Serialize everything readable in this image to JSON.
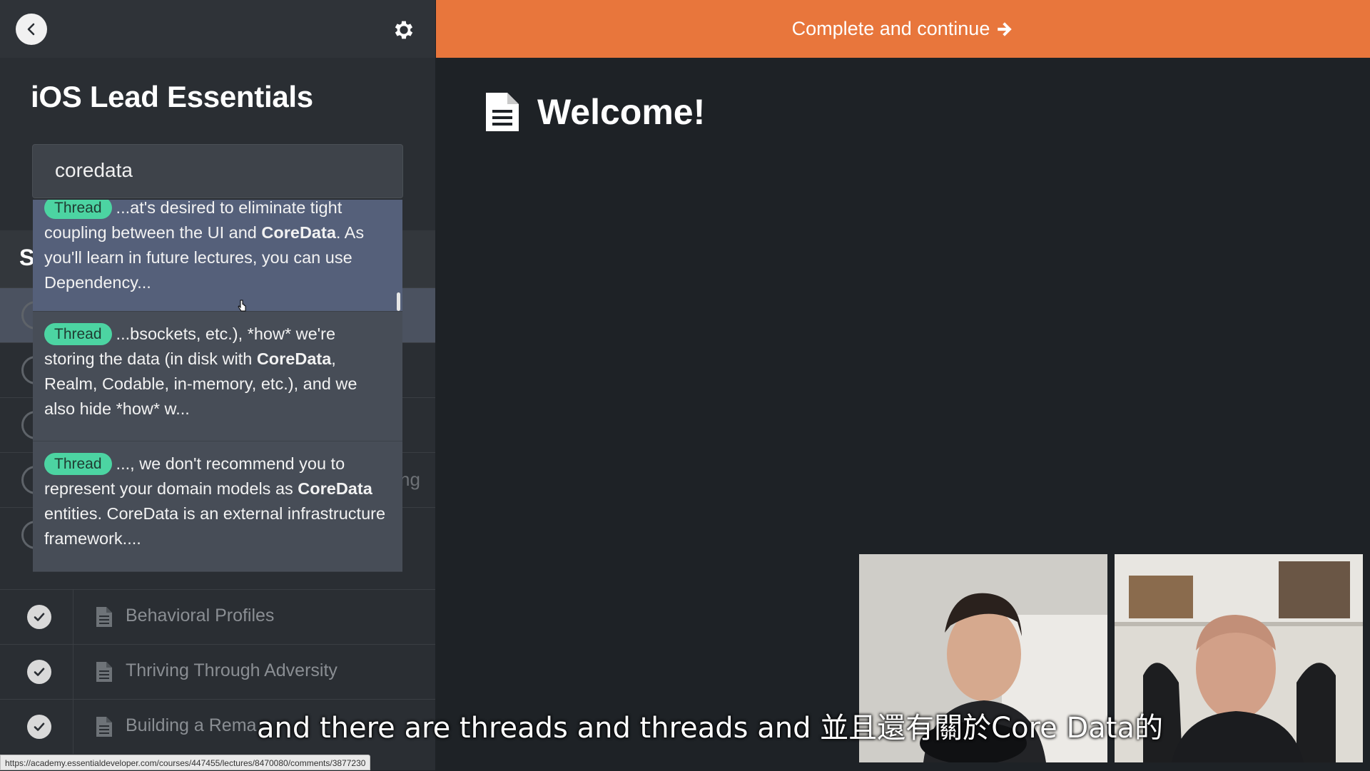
{
  "course": {
    "title": "iOS Lead Essentials"
  },
  "search": {
    "value": "coredata"
  },
  "results": [
    {
      "badge": "Thread",
      "before": "...at's desired to eliminate tight coupling between the UI and ",
      "highlight": "CoreData",
      "after": ". As you'll learn in future lectures, you can use Dependency..."
    },
    {
      "badge": "Thread",
      "before": "...bsockets, etc.), *how* we're storing the data (in disk with ",
      "highlight": "CoreData",
      "after": ", Realm, Codable, in-memory, etc.), and we also hide *how* w..."
    },
    {
      "badge": "Thread",
      "before": "..., we don't recommend you to represent your domain models as ",
      "highlight": "CoreData",
      "after": " entities. CoreData is an external infrastructure framework...."
    }
  ],
  "background_list": {
    "section_letter": "S",
    "row_tail_text": "ng"
  },
  "lessons": [
    {
      "label": "Behavioral Profiles"
    },
    {
      "label": "Thriving Through Adversity"
    },
    {
      "label": "Building a Rema"
    }
  ],
  "topbar": {
    "label": "Complete and continue"
  },
  "page": {
    "title": "Welcome!"
  },
  "subtitle": "and there are threads and threads and 並且還有關於Core Data的",
  "status_url": "https://academy.essentialdeveloper.com/courses/447455/lectures/8470080/comments/3877230",
  "colors": {
    "accent": "#e8763c",
    "badge": "#4cd4a2",
    "sidebar": "#2a2e33",
    "main": "#1e2226"
  },
  "icons": [
    "chevron-left-icon",
    "gear-icon",
    "document-icon",
    "check-icon",
    "arrow-right-icon"
  ]
}
